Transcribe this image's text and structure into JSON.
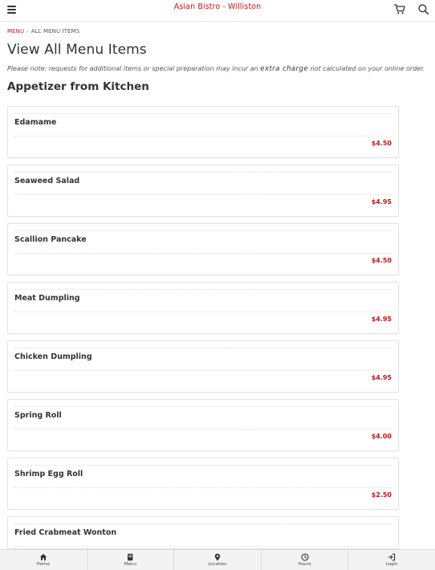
{
  "header": {
    "restaurant_title": "Asian Bistro - Williston",
    "menu_icon": "hamburger-menu-icon",
    "cart_icon": "cart-icon",
    "search_icon": "search-icon"
  },
  "breadcrumb": {
    "root_label": "MENU",
    "separator": "›",
    "current_label": "ALL MENU ITEMS"
  },
  "page": {
    "title": "View All Menu Items",
    "note_prefix": "Please note: requests for additional items or special preparation may incur an",
    "note_emphasis": "extra charge",
    "note_suffix": "not calculated on your online order.",
    "section_title": "Appetizer from Kitchen"
  },
  "items": [
    {
      "name": "Edamame",
      "price": "$4.50"
    },
    {
      "name": "Seaweed Salad",
      "price": "$4.95"
    },
    {
      "name": "Scallion Pancake",
      "price": "$4.50"
    },
    {
      "name": "Meat Dumpling",
      "price": "$4.95"
    },
    {
      "name": "Chicken Dumpling",
      "price": "$4.95"
    },
    {
      "name": "Spring Roll",
      "price": "$4.00"
    },
    {
      "name": "Shrimp Egg Roll",
      "price": "$2.50"
    },
    {
      "name": "Fried Crabmeat Wonton",
      "price": ""
    }
  ],
  "bottom_nav": [
    {
      "label": "Home",
      "icon": "home-icon"
    },
    {
      "label": "Menu",
      "icon": "book-icon"
    },
    {
      "label": "Location",
      "icon": "map-pin-icon"
    },
    {
      "label": "Hours",
      "icon": "clock-icon"
    },
    {
      "label": "Login",
      "icon": "login-icon"
    }
  ],
  "colors": {
    "brand_red": "#c0161c",
    "text_dark": "#333333",
    "card_border": "#e3e3e3",
    "nav_bg": "#f3f3f3"
  }
}
